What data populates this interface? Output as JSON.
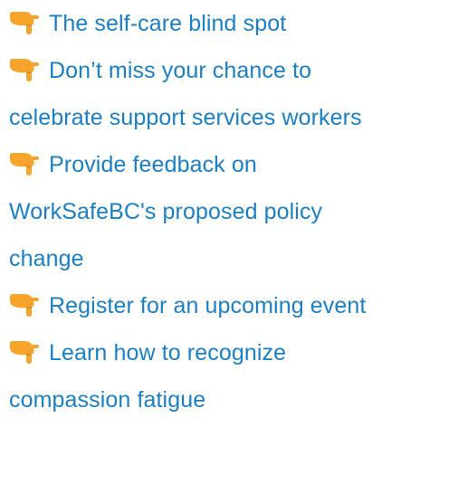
{
  "pointer_icon": "backhand-index-pointing-down-icon",
  "link_color": "#1b7fc4",
  "items": [
    {
      "lines": [
        "The self-care blind spot"
      ]
    },
    {
      "lines": [
        "Don’t miss your chance to",
        "celebrate support services workers"
      ]
    },
    {
      "lines": [
        "Provide feedback on",
        "WorkSafeBC's proposed policy",
        "change"
      ]
    },
    {
      "lines": [
        "Register for an upcoming event"
      ]
    },
    {
      "lines": [
        "Learn how to recognize",
        "compassion fatigue"
      ]
    }
  ]
}
